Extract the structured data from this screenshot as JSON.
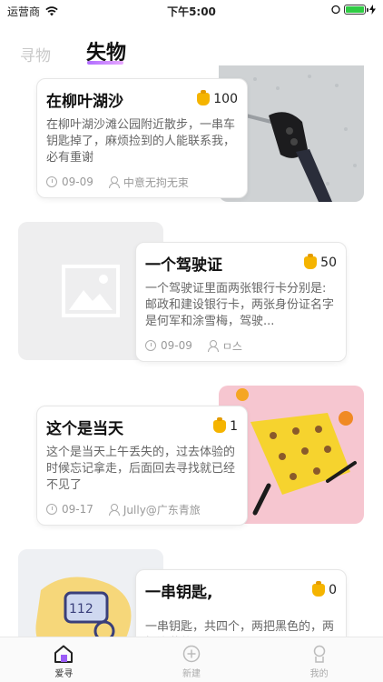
{
  "status_bar": {
    "carrier": "运营商",
    "time": "下午5:00"
  },
  "header": {
    "tabs": [
      {
        "label": "寻物"
      },
      {
        "label": "失物"
      }
    ]
  },
  "feed": {
    "items": [
      {
        "title": "在柳叶湖沙",
        "reward": "100",
        "description": "在柳叶湖沙滩公园附近散步，一串车钥匙掉了，麻烦捡到的人能联系我，必有重谢",
        "date": "09-09",
        "user": "中意无拘无束",
        "image": "car-key-photo"
      },
      {
        "title": "一个驾驶证",
        "reward": "50",
        "description": "一个驾驶证里面两张银行卡分别是:邮政和建设银行卡，两张身份证名字是何军和涂雪梅，驾驶...",
        "date": "09-09",
        "user": "ㅁ스",
        "image": "image-placeholder"
      },
      {
        "title": "这个是当天",
        "reward": "1",
        "description": "这个是当天上午丢失的，过去体验的时候忘记拿走，后面回去寻找就已经不见了",
        "date": "09-17",
        "user": "Jully@广东青旅",
        "image": "umbrella-photo"
      },
      {
        "title": "一串钥匙,",
        "reward": "0",
        "description": "一串钥匙，共四个，两把黑色的，两把浅黄的",
        "image": "keys-illustration"
      }
    ]
  },
  "tabbar": {
    "items": [
      {
        "label": "爱寻"
      },
      {
        "label": "新建"
      },
      {
        "label": "我的"
      }
    ]
  }
}
